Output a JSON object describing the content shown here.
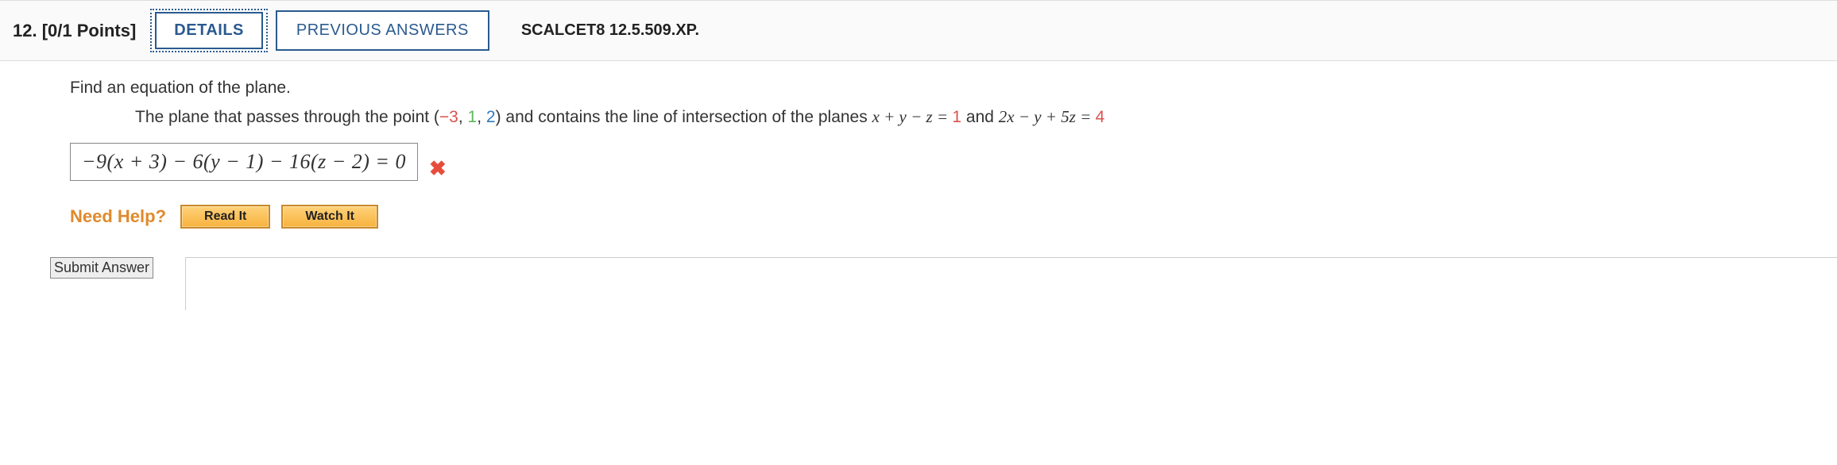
{
  "header": {
    "number": "12.",
    "points": "[0/1 Points]",
    "details": "DETAILS",
    "previous": "PREVIOUS ANSWERS",
    "source": "SCALCET8 12.5.509.XP."
  },
  "question": {
    "line1": "Find an equation of the plane.",
    "line2_pre": "The plane that passes through the point  (",
    "point_neg3": "−3",
    "point_sep1": ", ",
    "point_one": "1",
    "point_sep2": ", ",
    "point_two": "2",
    "line2_mid": ")  and contains the line of intersection of the planes  ",
    "eq1_lhs": "x + y − z = ",
    "eq1_rhs": "1",
    "line2_and": " and ",
    "eq2_lhs": "2x − y + 5z = ",
    "eq2_rhs": "4"
  },
  "answer": {
    "expr": "−9(x + 3) − 6(y − 1) − 16(z − 2) = 0",
    "status_icon": "✖"
  },
  "help": {
    "label": "Need Help?",
    "read": "Read It",
    "watch": "Watch It"
  },
  "submit": "Submit Answer"
}
